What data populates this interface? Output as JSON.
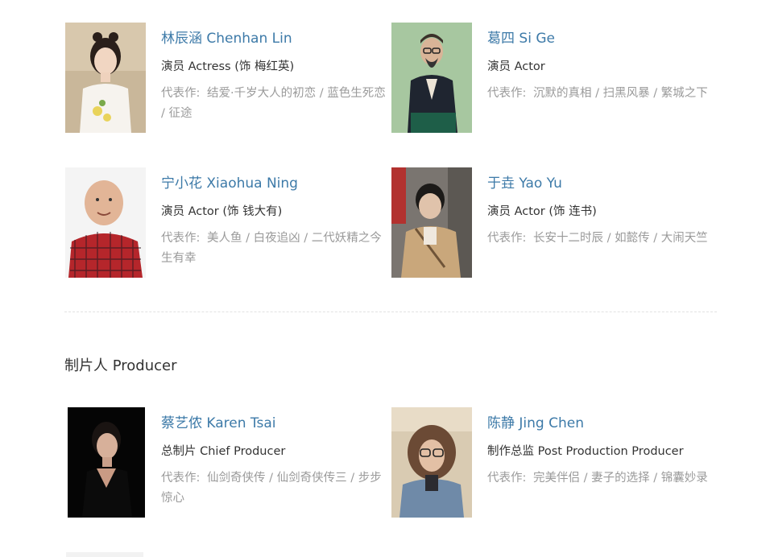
{
  "cast": [
    {
      "name": "林辰涵 Chenhan Lin",
      "role": "演员 Actress (饰 梅红英)",
      "works_label": "代表作:",
      "works": "结爱·千岁大人的初恋 / 蓝色生死恋 / 征途",
      "photo": "avatar-photo-chenhan-lin"
    },
    {
      "name": "葛四 Si Ge",
      "role": "演员 Actor",
      "works_label": "代表作:",
      "works": "沉默的真相 / 扫黑风暴 / 繁城之下",
      "photo": "avatar-photo-si-ge"
    },
    {
      "name": "宁小花 Xiaohua Ning",
      "role": "演员 Actor (饰 钱大有)",
      "works_label": "代表作:",
      "works": "美人鱼 / 白夜追凶 / 二代妖精之今生有幸",
      "photo": "avatar-photo-xiaohua-ning"
    },
    {
      "name": "于垚 Yao Yu",
      "role": "演员 Actor (饰 连书)",
      "works_label": "代表作:",
      "works": "长安十二时辰 / 如懿传 / 大闹天竺",
      "photo": "avatar-photo-yao-yu"
    }
  ],
  "producer_section": {
    "title": "制片人 Producer",
    "people": [
      {
        "name": "蔡艺侬 Karen Tsai",
        "role": "总制片 Chief Producer",
        "works_label": "代表作:",
        "works": "仙剑奇侠传 / 仙剑奇侠传三 / 步步惊心",
        "photo": "avatar-photo-karen-tsai"
      },
      {
        "name": "陈静 Jing Chen",
        "role": "制作总监 Post Production Producer",
        "works_label": "代表作:",
        "works": "完美伴侣 / 妻子的选择 / 锦囊妙录",
        "photo": "avatar-photo-jing-chen"
      }
    ]
  },
  "colors": {
    "name_link": "#3d7aa8",
    "role_text": "#333333",
    "works_text": "#9a9a9a",
    "divider": "#e2e2e2"
  }
}
